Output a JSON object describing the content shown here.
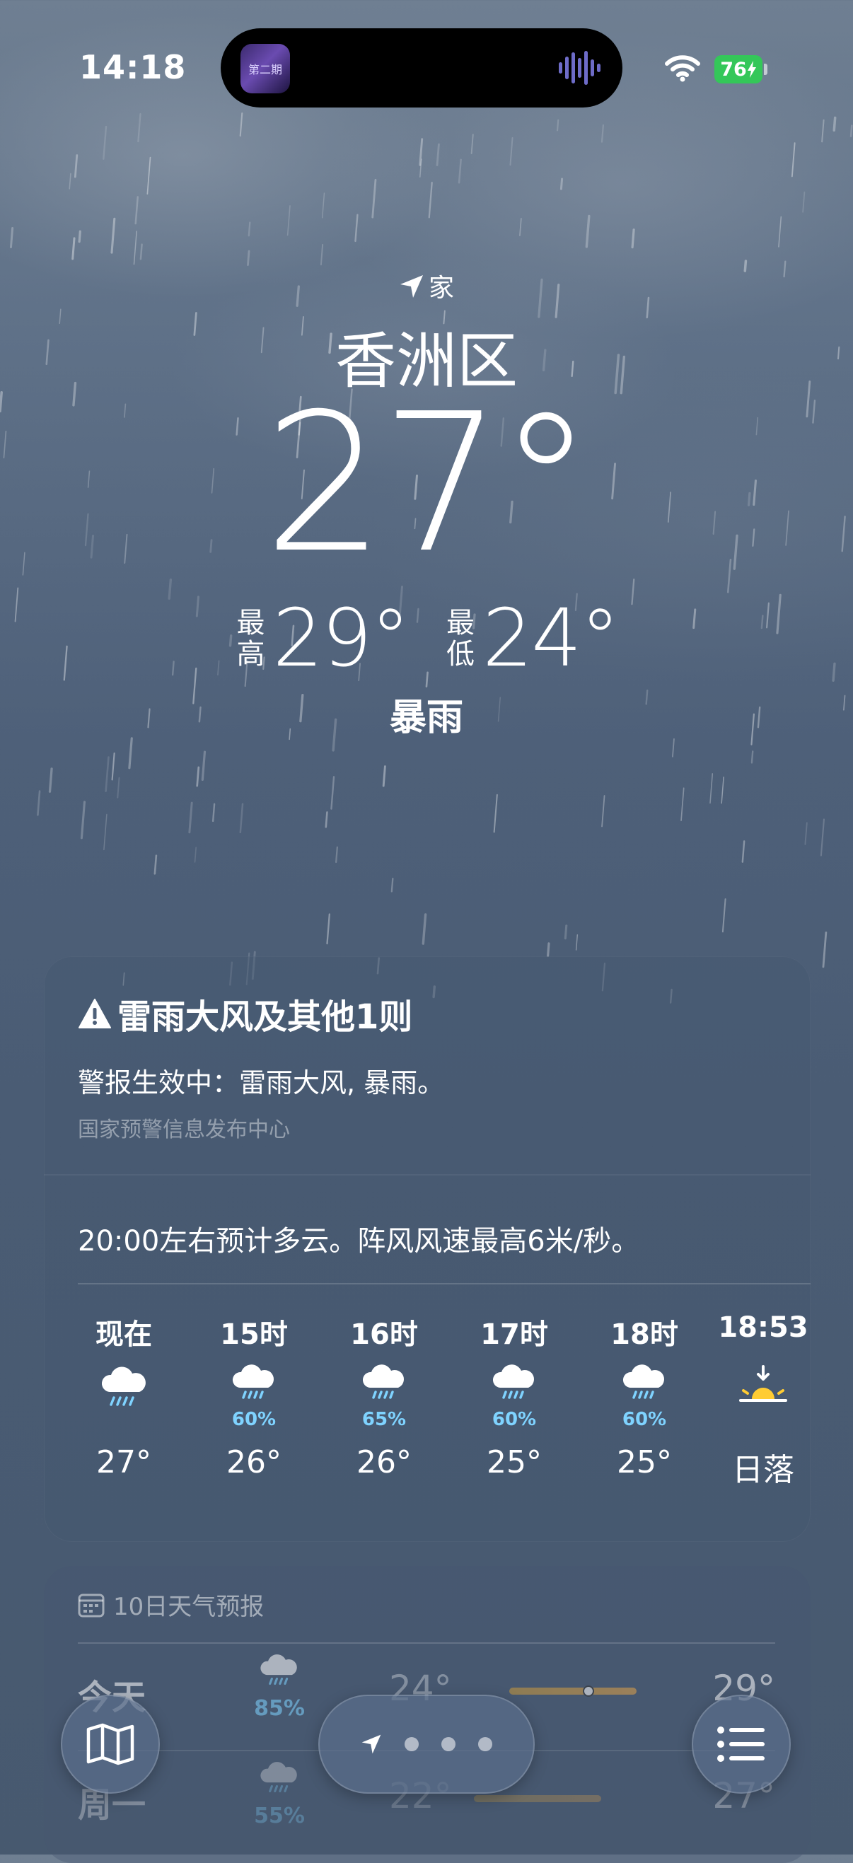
{
  "status_bar": {
    "time": "14:18",
    "battery": "76",
    "island_app_label": "第二期"
  },
  "header": {
    "location_label": "家",
    "city": "香洲区",
    "temperature": "27°",
    "high_label": "最高",
    "high": "29°",
    "low_label": "最低",
    "low": "24°",
    "condition": "暴雨"
  },
  "alert": {
    "title": "雷雨大风及其他1则",
    "body": "警报生效中：雷雨大风, 暴雨。",
    "source": "国家预警信息发布中心"
  },
  "hourly": {
    "summary": "20:00左右预计多云。阵风风速最高6米/秒。",
    "items": [
      {
        "label": "现在",
        "icon": "rain-cloud-icon",
        "precip": "",
        "temp": "27°"
      },
      {
        "label": "15时",
        "icon": "rain-cloud-icon",
        "precip": "60%",
        "temp": "26°"
      },
      {
        "label": "16时",
        "icon": "rain-cloud-icon",
        "precip": "65%",
        "temp": "26°"
      },
      {
        "label": "17时",
        "icon": "rain-cloud-icon",
        "precip": "60%",
        "temp": "25°"
      },
      {
        "label": "18时",
        "icon": "rain-cloud-icon",
        "precip": "60%",
        "temp": "25°"
      },
      {
        "label": "18:53",
        "icon": "sunset-icon",
        "precip": "",
        "temp": "日落"
      }
    ]
  },
  "forecast": {
    "title": "10日天气预报",
    "days": [
      {
        "name": "今天",
        "icon": "rain-cloud-icon",
        "precip": "85%",
        "low": "24°",
        "high": "29°",
        "current_position": 0.62
      },
      {
        "name": "周一",
        "icon": "rain-cloud-icon",
        "precip": "55%",
        "low": "22°",
        "high": "27°"
      }
    ]
  },
  "colors": {
    "precip": "#7fd3ff",
    "battery": "#34c759",
    "sunset": "#ffcc33",
    "temp_bar": "#e0a14a"
  }
}
